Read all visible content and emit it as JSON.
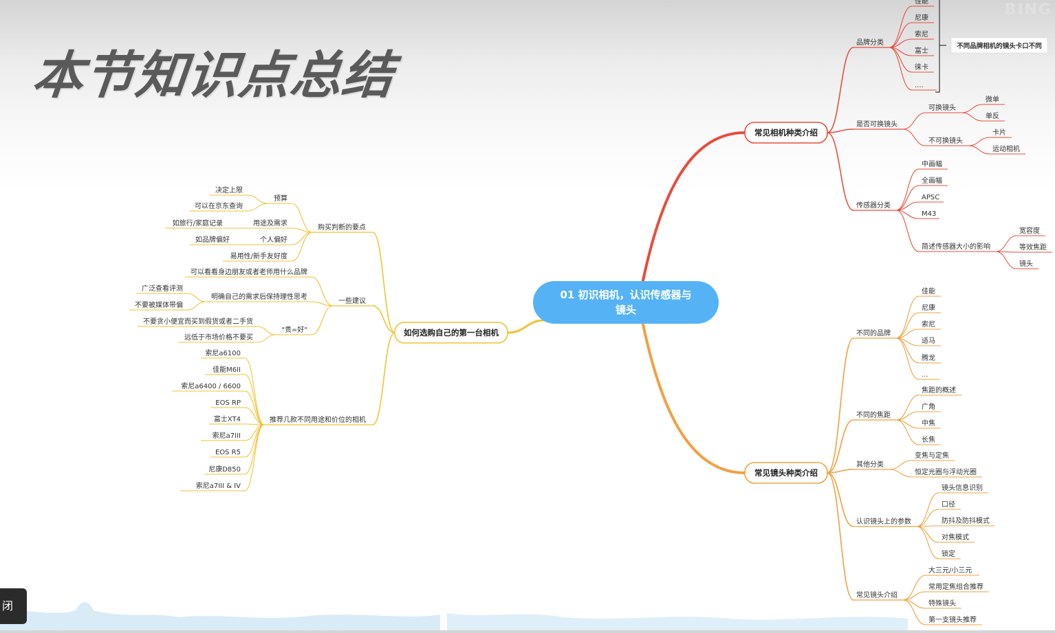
{
  "header": {
    "title": "本节知识点总结",
    "watermark": "BING"
  },
  "overlay": {
    "close_label": "闭"
  },
  "mindmap": {
    "root": "01 初识相机，认识传感器与镜头",
    "root_lines": [
      "01 初识相机，认识传感器与",
      "镜头"
    ],
    "branches": [
      {
        "id": "left",
        "label": "如何选购自己的第一台相机",
        "side": "left",
        "color": "#f1c232",
        "children": [
          {
            "label": "购买判断的要点",
            "children": [
              {
                "label": "预算",
                "children": [
                  {
                    "label": "决定上限"
                  },
                  {
                    "label": "可以在京东查询"
                  }
                ]
              },
              {
                "label": "用途及需求",
                "children": [
                  {
                    "label": "如旅行/家庭记录"
                  }
                ]
              },
              {
                "label": "个人偏好",
                "children": [
                  {
                    "label": "如品牌偏好"
                  }
                ]
              },
              {
                "label": "易用性/新手友好度"
              }
            ]
          },
          {
            "label": "一些建议",
            "children": [
              {
                "label": "可以看看身边朋友或者老师用什么品牌"
              },
              {
                "label": "明确自己的需求后保持理性思考",
                "children": [
                  {
                    "label": "广泛查看评测"
                  },
                  {
                    "label": "不要被媒体带偏"
                  }
                ]
              },
              {
                "label": "\"贵=好\"",
                "children": [
                  {
                    "label": "不要贪小便宜而买到假货或者二手货"
                  },
                  {
                    "label": "远低于市场价格不要买"
                  }
                ]
              }
            ]
          },
          {
            "label": "推荐几款不同用途和价位的相机",
            "children": [
              {
                "label": "索尼a6100"
              },
              {
                "label": "佳能M6II"
              },
              {
                "label": "索尼a6400 / 6600"
              },
              {
                "label": "EOS RP"
              },
              {
                "label": "富士XT4"
              },
              {
                "label": "索尼a7III"
              },
              {
                "label": "EOS R5"
              },
              {
                "label": "尼康D850"
              },
              {
                "label": "索尼a7III & IV"
              }
            ]
          }
        ]
      },
      {
        "id": "camera",
        "label": "常见相机种类介绍",
        "side": "right",
        "color": "#e84c3d",
        "children": [
          {
            "label": "品牌分类",
            "children": [
              {
                "label": "佳能"
              },
              {
                "label": "尼康"
              },
              {
                "label": "索尼"
              },
              {
                "label": "富士"
              },
              {
                "label": "徕卡"
              },
              {
                "label": "...."
              }
            ],
            "note": "不同品牌相机的镜头卡口不同"
          },
          {
            "label": "是否可换镜头",
            "children": [
              {
                "label": "可换镜头",
                "children": [
                  {
                    "label": "微单"
                  },
                  {
                    "label": "单反"
                  }
                ]
              },
              {
                "label": "不可换镜头",
                "children": [
                  {
                    "label": "卡片"
                  },
                  {
                    "label": "运动相机"
                  }
                ]
              }
            ]
          },
          {
            "label": "传感器分类",
            "children": [
              {
                "label": "中画幅"
              },
              {
                "label": "全画幅"
              },
              {
                "label": "APSC"
              },
              {
                "label": "M43"
              },
              {
                "label": "简述传感器大小的影响",
                "children": [
                  {
                    "label": "宽容度"
                  },
                  {
                    "label": "等效焦距"
                  },
                  {
                    "label": "镜头"
                  }
                ]
              }
            ]
          }
        ]
      },
      {
        "id": "lens",
        "label": "常见镜头种类介绍",
        "side": "right",
        "color": "#f0a040",
        "children": [
          {
            "label": "不同的品牌",
            "children": [
              {
                "label": "佳能"
              },
              {
                "label": "尼康"
              },
              {
                "label": "索尼"
              },
              {
                "label": "适马"
              },
              {
                "label": "腾龙"
              },
              {
                "label": "..."
              }
            ]
          },
          {
            "label": "不同的焦距",
            "children": [
              {
                "label": "焦距的概述"
              },
              {
                "label": "广角"
              },
              {
                "label": "中焦"
              },
              {
                "label": "长焦"
              }
            ]
          },
          {
            "label": "其他分类",
            "children": [
              {
                "label": "变焦与定焦"
              },
              {
                "label": "恒定光圈与浮动光圈"
              }
            ]
          },
          {
            "label": "认识镜头上的参数",
            "children": [
              {
                "label": "镜头信息识别"
              },
              {
                "label": "口径"
              },
              {
                "label": "防抖及防抖模式"
              },
              {
                "label": "对焦模式"
              },
              {
                "label": "锁定"
              }
            ]
          },
          {
            "label": "常见镜头介绍",
            "children": [
              {
                "label": "大三元/小三元"
              },
              {
                "label": "常用定焦组合推荐"
              },
              {
                "label": "特殊镜头"
              },
              {
                "label": "第一支镜头推荐"
              }
            ]
          }
        ]
      }
    ]
  }
}
